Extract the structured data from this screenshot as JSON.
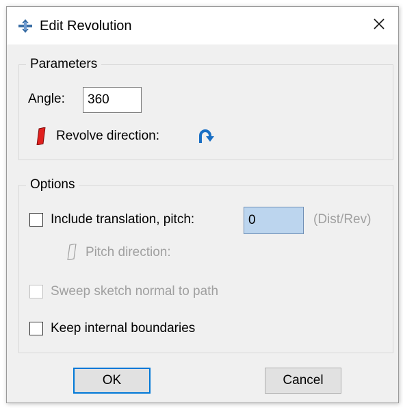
{
  "window": {
    "title": "Edit Revolution",
    "app_icon": "abaqus-revolve-icon",
    "close_icon": "close-icon"
  },
  "parameters": {
    "legend": "Parameters",
    "angle_label": "Angle:",
    "angle_value": "360",
    "revolve_direction_label": "Revolve direction:",
    "revolve_icon": "red-plane-icon",
    "flip_icon": "curved-arrow-icon"
  },
  "options": {
    "legend": "Options",
    "include_translation_label": "Include translation, pitch:",
    "include_translation_checked": false,
    "pitch_value": "0",
    "pitch_unit": "(Dist/Rev)",
    "pitch_direction_label": "Pitch direction:",
    "sweep_label": "Sweep sketch normal to path",
    "sweep_checked": false,
    "sweep_disabled": true,
    "keep_boundaries_label": "Keep internal boundaries",
    "keep_boundaries_checked": false
  },
  "buttons": {
    "ok": "OK",
    "cancel": "Cancel"
  },
  "colors": {
    "accent": "#0078d7",
    "window_bg": "#f0f0f0",
    "plane_red": "#e0201e",
    "arrow_blue": "#1a6fc4",
    "disabled_text": "#a0a0a0",
    "highlight_field": "#bcd5ee"
  }
}
